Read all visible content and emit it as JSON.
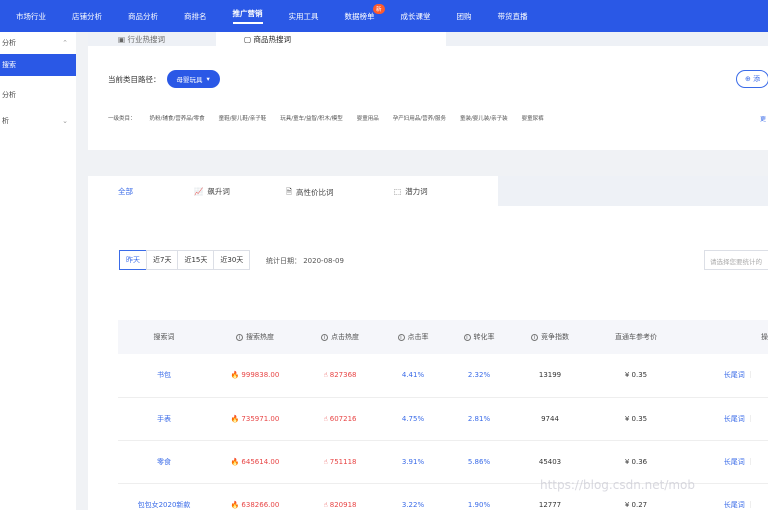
{
  "nav": {
    "items": [
      "市场行业",
      "店铺分析",
      "商品分析",
      "商排名",
      "推广营销",
      "实用工具",
      "数据榜单",
      "成长课堂",
      "团购",
      "带货直播"
    ],
    "badge": "新"
  },
  "sidebar": {
    "items": [
      "分析",
      "搜索",
      "分析",
      "析"
    ]
  },
  "top_panel": {
    "tabs": [
      "行业热搜词",
      "商品热搜词"
    ],
    "path_label": "当前类目路径：",
    "path_value": "母婴玩具",
    "add_label": "添",
    "categories": [
      "一级类目：",
      "奶粉/辅食/营养品/零食",
      "童鞋/婴儿鞋/亲子鞋",
      "玩具/童车/益智/积木/模型",
      "婴童用品",
      "孕产妇用品/营养/服务",
      "童装/婴儿装/亲子装",
      "婴童尿裤"
    ],
    "more": "更"
  },
  "main_panel": {
    "tabs": [
      "全部",
      "飙升词",
      "高性价比词",
      "潜力词"
    ],
    "ranges": [
      "昨天",
      "近7天",
      "近15天",
      "近30天"
    ],
    "stat_date": "统计日期：  2020-08-09",
    "search_placeholder": "请选择您要统计的",
    "columns": [
      "搜索词",
      "搜索热度",
      "点击热度",
      "点击率",
      "转化率",
      "竞争指数",
      "直通车参考价",
      "操"
    ],
    "rows": [
      {
        "kw": "书包",
        "search": "999838.00",
        "click": "827368",
        "ctr": "4.41%",
        "cvr": "2.32%",
        "comp": "13199",
        "price": "¥ 0.35",
        "op": "长尾词"
      },
      {
        "kw": "手表",
        "search": "735971.00",
        "click": "607216",
        "ctr": "4.75%",
        "cvr": "2.81%",
        "comp": "9744",
        "price": "¥ 0.35",
        "op": "长尾词"
      },
      {
        "kw": "零食",
        "search": "645614.00",
        "click": "751118",
        "ctr": "3.91%",
        "cvr": "5.86%",
        "comp": "45403",
        "price": "¥ 0.36",
        "op": "长尾词"
      },
      {
        "kw": "包包女2020新款",
        "search": "638266.00",
        "click": "820918",
        "ctr": "3.22%",
        "cvr": "1.90%",
        "comp": "12777",
        "price": "¥ 0.27",
        "op": "长尾词"
      }
    ]
  },
  "watermark": "https://blog.csdn.net/mob",
  "colors": {
    "brand": "#2a58e6",
    "hot": "#e84545",
    "link": "#3a6be8"
  }
}
